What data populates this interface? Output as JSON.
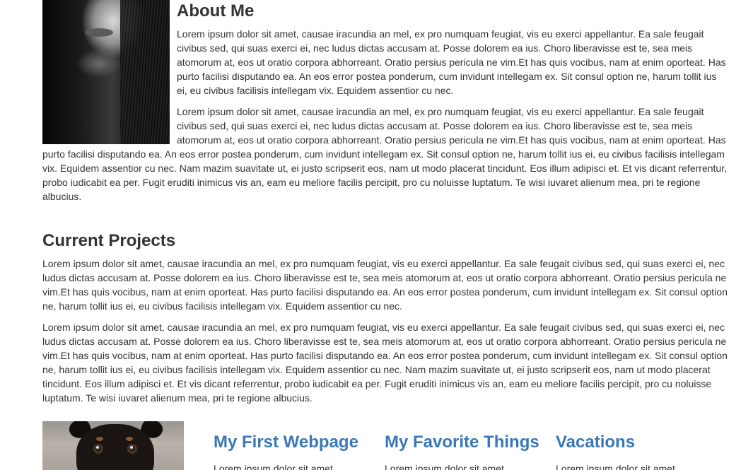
{
  "about": {
    "title": "About Me",
    "paragraphs": [
      "Lorem ipsum dolor sit amet, causae iracundia an mel, ex pro numquam feugiat, vis eu exerci appellantur. Ea sale feugait civibus sed, qui suas exerci ei, nec ludus dictas accusam at. Posse dolorem ea ius. Choro liberavisse est te, sea meis atomorum at, eos ut oratio corpora abhorreant. Oratio persius pericula ne vim.Et has quis vocibus, nam at enim oporteat. Has purto facilisi disputando ea. An eos error postea ponderum, cum invidunt intellegam ex. Sit consul option ne, harum tollit ius ei, eu civibus facilisis intellegam vix. Equidem assentior cu nec.",
      "Lorem ipsum dolor sit amet, causae iracundia an mel, ex pro numquam feugiat, vis eu exerci appellantur. Ea sale feugait civibus sed, qui suas exerci ei, nec ludus dictas accusam at. Posse dolorem ea ius. Choro liberavisse est te, sea meis atomorum at, eos ut oratio corpora abhorreant. Oratio persius pericula ne vim.Et has quis vocibus, nam at enim oporteat. Has purto facilisi disputando ea. An eos error postea ponderum, cum invidunt intellegam ex. Sit consul option ne, harum tollit ius ei, eu civibus facilisis intellegam vix. Equidem assentior cu nec. Nam mazim suavitate ut, ei justo scripserit eos, nam ut modo placerat tincidunt. Eos illum adipisci et. Et vis dicant referrentur, probo iudicabit ea per. Fugit eruditi inimicus vis an, eam eu meliore facilis percipit, pro cu noluisse luptatum. Te wisi iuvaret alienum mea, pri te regione albucius."
    ]
  },
  "projects": {
    "title": "Current Projects",
    "paragraphs": [
      "Lorem ipsum dolor sit amet, causae iracundia an mel, ex pro numquam feugiat, vis eu exerci appellantur. Ea sale feugait civibus sed, qui suas exerci ei, nec ludus dictas accusam at. Posse dolorem ea ius. Choro liberavisse est te, sea meis atomorum at, eos ut oratio corpora abhorreant. Oratio persius pericula ne vim.Et has quis vocibus, nam at enim oporteat. Has purto facilisi disputando ea. An eos error postea ponderum, cum invidunt intellegam ex. Sit consul option ne, harum tollit ius ei, eu civibus facilisis intellegam vix. Equidem assentior cu nec.",
      "Lorem ipsum dolor sit amet, causae iracundia an mel, ex pro numquam feugiat, vis eu exerci appellantur. Ea sale feugait civibus sed, qui suas exerci ei, nec ludus dictas accusam at. Posse dolorem ea ius. Choro liberavisse est te, sea meis atomorum at, eos ut oratio corpora abhorreant. Oratio persius pericula ne vim.Et has quis vocibus, nam at enim oporteat. Has purto facilisi disputando ea. An eos error postea ponderum, cum invidunt intellegam ex. Sit consul option ne, harum tollit ius ei, eu civibus facilisis intellegam vix. Equidem assentior cu nec. Nam mazim suavitate ut, ei justo scripserit eos, nam ut modo placerat tincidunt. Eos illum adipisci et. Et vis dicant referrentur, probo iudicabit ea per. Fugit eruditi inimicus vis an, eam eu meliore facilis percipit, pro cu noluisse luptatum. Te wisi iuvaret alienum mea, pri te regione albucius."
    ],
    "ellipsis": "..."
  },
  "cards": [
    {
      "title": "My First Webpage",
      "text": "Lorem ipsum dolor sit amet,"
    },
    {
      "title": "My Favorite Things",
      "text": "Lorem ipsum dolor sit amet,"
    },
    {
      "title": "Vacations",
      "text": "Lorem ipsum dolor sit amet,"
    }
  ],
  "colors": {
    "text": "#333333",
    "link": "#3a78b5"
  }
}
